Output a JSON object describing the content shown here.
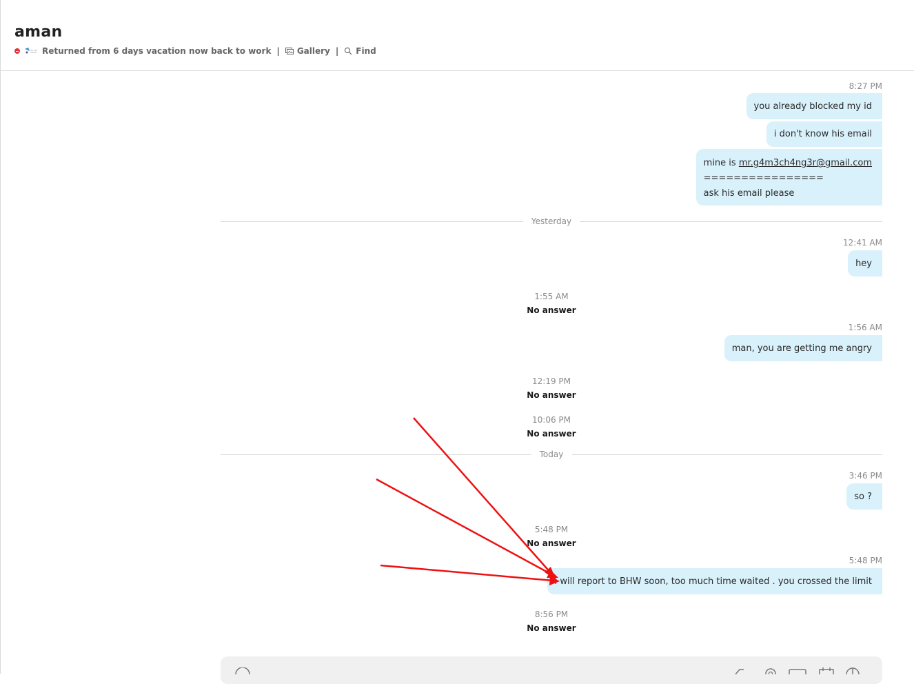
{
  "header": {
    "title": "aman",
    "mood": "Returned from 6 days vacation now back to work",
    "separator": "|",
    "gallery_label": "Gallery",
    "find_label": "Find"
  },
  "messages": {
    "m1": {
      "time": "8:27 PM",
      "text": "you already blocked my id"
    },
    "m2": {
      "text": "i don't know his email"
    },
    "m3": {
      "line1_prefix": "mine is ",
      "email": "mr.g4m3ch4ng3r@gmail.com",
      "line2": "================",
      "line3": "ask his email please"
    },
    "divider_yesterday": "Yesterday",
    "m4": {
      "time": "12:41 AM",
      "text": "hey"
    },
    "c1": {
      "time": "1:55 AM",
      "status": "No answer"
    },
    "m5": {
      "time": "1:56 AM",
      "text": "man, you are getting me angry"
    },
    "c2": {
      "time": "12:19 PM",
      "status": "No answer"
    },
    "c3": {
      "time": "10:06 PM",
      "status": "No answer"
    },
    "divider_today": "Today",
    "m6": {
      "time": "3:46 PM",
      "text": "so ?"
    },
    "c4": {
      "time": "5:48 PM",
      "status": "No answer"
    },
    "m7": {
      "time": "5:48 PM",
      "text": "i will report to BHW soon, too much time waited . you crossed the limit"
    },
    "c5": {
      "time": "8:56 PM",
      "status": "No answer"
    }
  },
  "colors": {
    "bubble_background": "#d9f1fb",
    "dnd_status": "#e0353b",
    "annotation_arrow": "#ee1111"
  },
  "icons": [
    "status-dnd-icon",
    "mood-image-icon",
    "gallery-icon",
    "search-icon",
    "emoji-icon",
    "attach-icon",
    "location-icon",
    "image-icon",
    "calendar-icon",
    "poll-icon"
  ]
}
